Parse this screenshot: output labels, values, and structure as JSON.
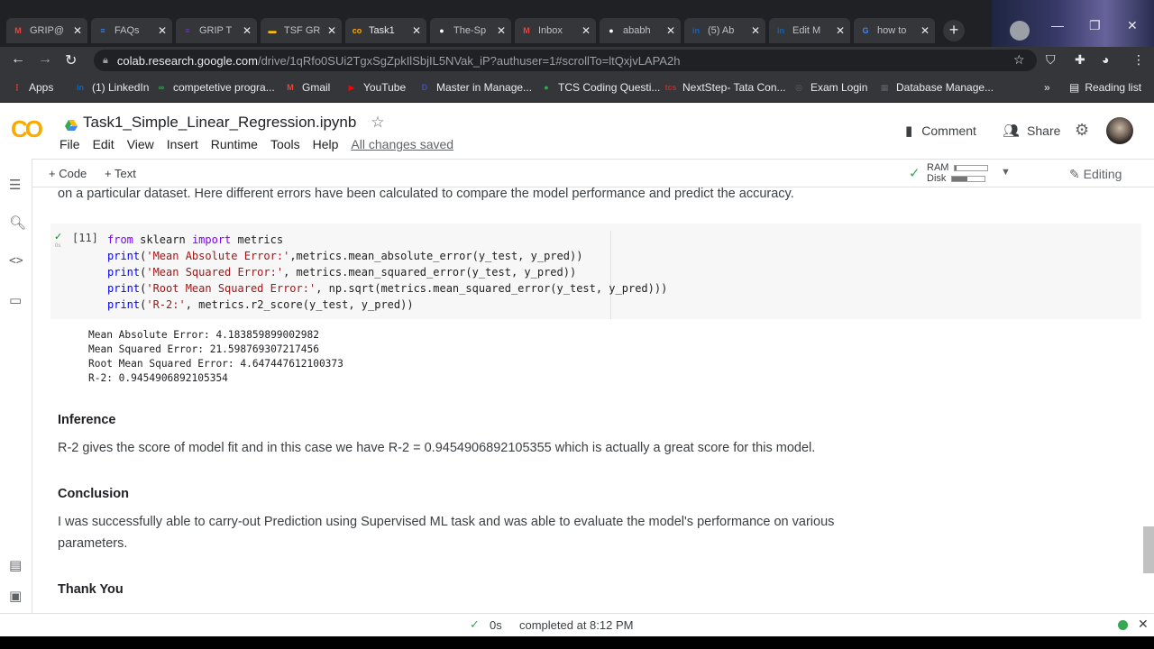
{
  "tabs": [
    {
      "label": "GRIP@",
      "color": "#ea4335",
      "glyph": "M"
    },
    {
      "label": "FAQs",
      "color": "#4285f4",
      "glyph": "≡"
    },
    {
      "label": "GRIP T",
      "color": "#673ab7",
      "glyph": "≡"
    },
    {
      "label": "TSF GR",
      "color": "#fbbc04",
      "glyph": "▬"
    },
    {
      "label": "Task1",
      "color": "#f9ab00",
      "glyph": "co"
    },
    {
      "label": "The-Sp",
      "color": "#ffffff",
      "glyph": "●"
    },
    {
      "label": "Inbox",
      "color": "#ea4335",
      "glyph": "M"
    },
    {
      "label": "ababh",
      "color": "#ffffff",
      "glyph": "●"
    },
    {
      "label": "(5) Ab",
      "color": "#0a66c2",
      "glyph": "in"
    },
    {
      "label": "Edit M",
      "color": "#0a66c2",
      "glyph": "in"
    },
    {
      "label": "how to",
      "color": "#4285f4",
      "glyph": "G"
    }
  ],
  "address_bar": {
    "host": "colab.research.google.com",
    "path": "/drive/1qRfo0SUi2TgxSgZpkIlSbjIL5NVak_iP?authuser=1#scrollTo=ltQxjvLAPA2h"
  },
  "bookmarks": [
    {
      "label": "Apps",
      "color": "#ea4335",
      "glyph": "⋮"
    },
    {
      "label": "(1) LinkedIn",
      "color": "#0a66c2",
      "glyph": "in"
    },
    {
      "label": "competetive progra...",
      "color": "#34a853",
      "glyph": "∞"
    },
    {
      "label": "Gmail",
      "color": "#ea4335",
      "glyph": "M"
    },
    {
      "label": "YouTube",
      "color": "#ff0000",
      "glyph": "▶"
    },
    {
      "label": "Master in Manage...",
      "color": "#3f51b5",
      "glyph": "D"
    },
    {
      "label": "TCS Coding Questi...",
      "color": "#34a853",
      "glyph": "●"
    },
    {
      "label": "NextStep- Tata Con...",
      "color": "#c62828",
      "glyph": "tcs"
    },
    {
      "label": "Exam Login",
      "color": "#5f6368",
      "glyph": "◎"
    },
    {
      "label": "Database Manage...",
      "color": "#5f6368",
      "glyph": "▦"
    }
  ],
  "reading_list": "Reading list",
  "notebook": {
    "title": "Task1_Simple_Linear_Regression.ipynb",
    "menu": [
      "File",
      "Edit",
      "View",
      "Insert",
      "Runtime",
      "Tools",
      "Help"
    ],
    "saved_status": "All changes saved",
    "comment": "Comment",
    "share": "Share"
  },
  "cell_toolbar": {
    "add_code": "+ Code",
    "add_text": "+ Text",
    "ram": "RAM",
    "disk": "Disk",
    "ram_fill": 0.05,
    "disk_fill": 0.45,
    "editing": "Editing"
  },
  "content": {
    "intro_tail": "on a particular dataset. Here different errors have been calculated to compare the model performance and predict the accuracy.",
    "cell_count": "[11]",
    "exec_time": "0s",
    "output_lines": [
      "Mean Absolute Error: 4.183859899002982",
      "Mean Squared Error: 21.598769307217456",
      "Root Mean Squared Error: 4.647447612100373",
      "R-2: 0.9454906892105354"
    ],
    "inference_heading": "Inference",
    "inference_text": "R-2 gives the score of model fit and in this case we have R-2 = 0.9454906892105355 which is actually a great score for this model.",
    "conclusion_heading": "Conclusion",
    "conclusion_line1": "I was successfully able to carry-out Prediction using Supervised ML task and was able to evaluate the model's performance on various",
    "conclusion_line2": "parameters.",
    "thanks_heading": "Thank You"
  },
  "status": {
    "time": "0s",
    "completed": "completed at 8:12 PM"
  }
}
